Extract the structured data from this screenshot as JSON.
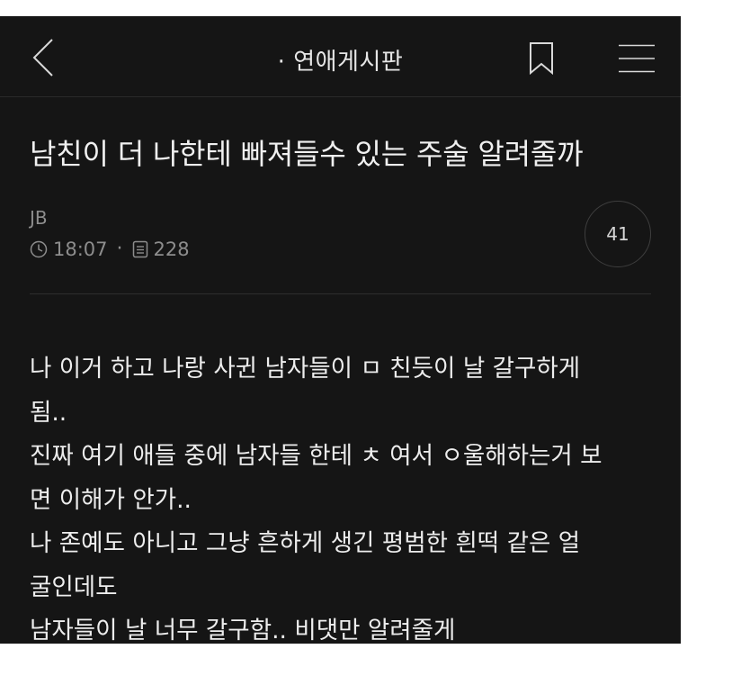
{
  "header": {
    "back_icon": "chevron-left-icon",
    "board_title": "· 연애게시판",
    "bookmark_icon": "bookmark-icon",
    "menu_icon": "hamburger-menu-icon"
  },
  "post": {
    "title": "남친이 더 나한테 빠져들수 있는 주술 알려줄까",
    "author": "JB",
    "time": "18:07",
    "time_icon": "clock-icon",
    "separator": "·",
    "views": "228",
    "views_icon": "document-icon",
    "comment_count": "41",
    "body_lines": [
      "나 이거 하고 나랑 사귄 남자들이 ㅁ 친듯이 날 갈구하게",
      "됨..",
      "진짜 여기 애들 중에 남자들 한테 ㅊ 여서 ㅇ울해하는거 보",
      "면 이해가 안가..",
      "나 존예도 아니고 그냥 흔하게 생긴 평범한 흰떡 같은 얼",
      "굴인데도",
      "남자들이 날 너무 갈구함.. 비댓만 알려줄게"
    ]
  },
  "colors": {
    "background": "#151515",
    "text": "#ececec",
    "muted": "#8d8d8d"
  }
}
